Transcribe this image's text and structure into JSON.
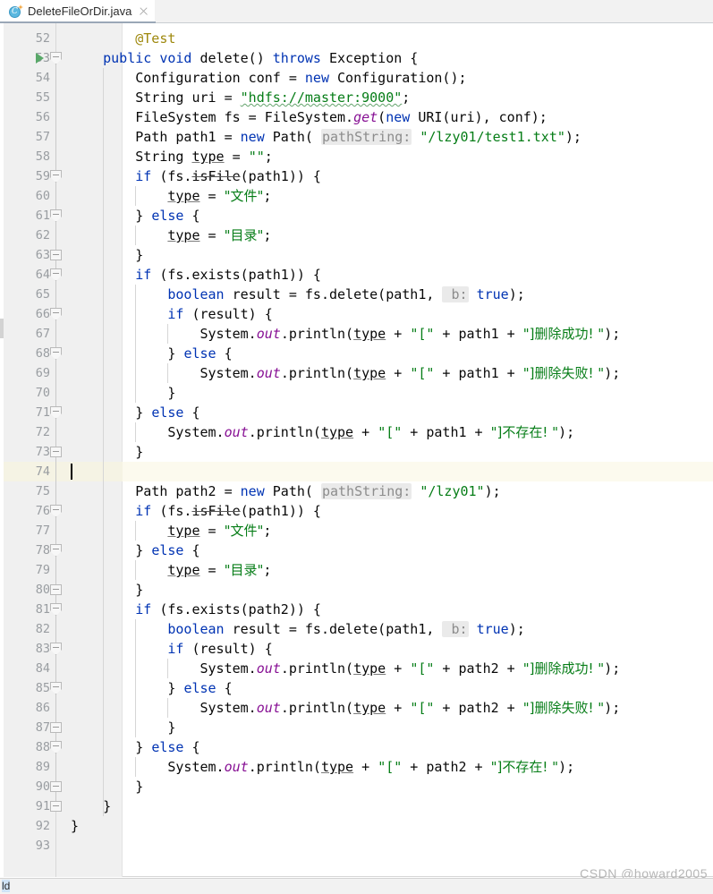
{
  "window": {
    "watermark": "CSDN @howard2005",
    "status_fragment": "ld"
  },
  "tabbar": {
    "tabs": [
      {
        "label": "DeleteFileOrDir.java",
        "icon": "java-class-icon",
        "icon_letter": "C",
        "close_icon": "close-icon",
        "active": true
      }
    ]
  },
  "editor": {
    "first_line": 52,
    "current_line": 74,
    "caret_line": 74,
    "colors": {
      "keyword": "#0033b3",
      "string": "#067d17",
      "annotation": "#9e880d",
      "static_member": "#871094",
      "gutter_bg": "#f0f0f0",
      "current_line_bg": "#fcfaee",
      "run_arrow": "#59a869",
      "tab_underline": "#9aa7b7"
    },
    "gutter": {
      "run_marker_line": 53,
      "fold_open_lines": [
        53,
        59,
        61,
        64,
        66,
        68,
        71,
        76,
        78,
        81,
        83,
        85,
        88
      ],
      "fold_close_lines": [
        63,
        73,
        80,
        87,
        90,
        91
      ]
    },
    "lines": [
      {
        "n": 52,
        "tokens": [
          {
            "t": "        ",
            "c": "plain"
          },
          {
            "t": "@Test",
            "c": "ann"
          }
        ]
      },
      {
        "n": 53,
        "tokens": [
          {
            "t": "    ",
            "c": "plain"
          },
          {
            "t": "public",
            "c": "kw"
          },
          {
            "t": " ",
            "c": "plain"
          },
          {
            "t": "void",
            "c": "kw"
          },
          {
            "t": " delete() ",
            "c": "plain"
          },
          {
            "t": "throws",
            "c": "kw"
          },
          {
            "t": " Exception {",
            "c": "plain"
          }
        ]
      },
      {
        "n": 54,
        "tokens": [
          {
            "t": "        Configuration conf = ",
            "c": "plain"
          },
          {
            "t": "new",
            "c": "kw"
          },
          {
            "t": " Configuration();",
            "c": "plain"
          }
        ]
      },
      {
        "n": 55,
        "tokens": [
          {
            "t": "        String uri = ",
            "c": "plain"
          },
          {
            "t": "\"hdfs://master:9000\"",
            "c": "str-squiggle"
          },
          {
            "t": ";",
            "c": "plain"
          }
        ]
      },
      {
        "n": 56,
        "tokens": [
          {
            "t": "        FileSystem fs = FileSystem.",
            "c": "plain"
          },
          {
            "t": "get",
            "c": "stat"
          },
          {
            "t": "(",
            "c": "plain"
          },
          {
            "t": "new",
            "c": "kw"
          },
          {
            "t": " URI(uri), conf);",
            "c": "plain"
          }
        ]
      },
      {
        "n": 57,
        "tokens": [
          {
            "t": "        Path path1 = ",
            "c": "plain"
          },
          {
            "t": "new",
            "c": "kw"
          },
          {
            "t": " Path( ",
            "c": "plain"
          },
          {
            "t": "pathString:",
            "c": "hint"
          },
          {
            "t": " ",
            "c": "plain"
          },
          {
            "t": "\"/lzy01/test1.txt\"",
            "c": "str"
          },
          {
            "t": ");",
            "c": "plain"
          }
        ]
      },
      {
        "n": 58,
        "tokens": [
          {
            "t": "        String ",
            "c": "plain"
          },
          {
            "t": "type",
            "c": "u"
          },
          {
            "t": " = ",
            "c": "plain"
          },
          {
            "t": "\"\"",
            "c": "str"
          },
          {
            "t": ";",
            "c": "plain"
          }
        ]
      },
      {
        "n": 59,
        "tokens": [
          {
            "t": "        ",
            "c": "plain"
          },
          {
            "t": "if",
            "c": "kw"
          },
          {
            "t": " (fs.",
            "c": "plain"
          },
          {
            "t": "isFile",
            "c": "strike"
          },
          {
            "t": "(path1)) {",
            "c": "plain"
          }
        ]
      },
      {
        "n": 60,
        "tokens": [
          {
            "t": "            ",
            "c": "plain"
          },
          {
            "t": "type",
            "c": "u"
          },
          {
            "t": " = ",
            "c": "plain"
          },
          {
            "t": "\"文件\"",
            "c": "str-cjk"
          },
          {
            "t": ";",
            "c": "plain"
          }
        ]
      },
      {
        "n": 61,
        "tokens": [
          {
            "t": "        } ",
            "c": "plain"
          },
          {
            "t": "else",
            "c": "kw"
          },
          {
            "t": " {",
            "c": "plain"
          }
        ]
      },
      {
        "n": 62,
        "tokens": [
          {
            "t": "            ",
            "c": "plain"
          },
          {
            "t": "type",
            "c": "u"
          },
          {
            "t": " = ",
            "c": "plain"
          },
          {
            "t": "\"目录\"",
            "c": "str-cjk"
          },
          {
            "t": ";",
            "c": "plain"
          }
        ]
      },
      {
        "n": 63,
        "tokens": [
          {
            "t": "        }",
            "c": "plain"
          }
        ]
      },
      {
        "n": 64,
        "tokens": [
          {
            "t": "        ",
            "c": "plain"
          },
          {
            "t": "if",
            "c": "kw"
          },
          {
            "t": " (fs.exists(path1)) {",
            "c": "plain"
          }
        ]
      },
      {
        "n": 65,
        "tokens": [
          {
            "t": "            ",
            "c": "plain"
          },
          {
            "t": "boolean",
            "c": "kw"
          },
          {
            "t": " result = fs.delete(path1, ",
            "c": "plain"
          },
          {
            "t": " b:",
            "c": "hint"
          },
          {
            "t": " ",
            "c": "plain"
          },
          {
            "t": "true",
            "c": "kw"
          },
          {
            "t": ");",
            "c": "plain"
          }
        ]
      },
      {
        "n": 66,
        "tokens": [
          {
            "t": "            ",
            "c": "plain"
          },
          {
            "t": "if",
            "c": "kw"
          },
          {
            "t": " (result) {",
            "c": "plain"
          }
        ]
      },
      {
        "n": 67,
        "tokens": [
          {
            "t": "                System.",
            "c": "plain"
          },
          {
            "t": "out",
            "c": "stat"
          },
          {
            "t": ".println(",
            "c": "plain"
          },
          {
            "t": "type",
            "c": "u"
          },
          {
            "t": " + ",
            "c": "plain"
          },
          {
            "t": "\"[\"",
            "c": "str"
          },
          {
            "t": " + path1 + ",
            "c": "plain"
          },
          {
            "t": "\"]删除成功! \"",
            "c": "str-cjk"
          },
          {
            "t": ");",
            "c": "plain"
          }
        ]
      },
      {
        "n": 68,
        "tokens": [
          {
            "t": "            } ",
            "c": "plain"
          },
          {
            "t": "else",
            "c": "kw"
          },
          {
            "t": " {",
            "c": "plain"
          }
        ]
      },
      {
        "n": 69,
        "tokens": [
          {
            "t": "                System.",
            "c": "plain"
          },
          {
            "t": "out",
            "c": "stat"
          },
          {
            "t": ".println(",
            "c": "plain"
          },
          {
            "t": "type",
            "c": "u"
          },
          {
            "t": " + ",
            "c": "plain"
          },
          {
            "t": "\"[\"",
            "c": "str"
          },
          {
            "t": " + path1 + ",
            "c": "plain"
          },
          {
            "t": "\"]删除失败! \"",
            "c": "str-cjk"
          },
          {
            "t": ");",
            "c": "plain"
          }
        ]
      },
      {
        "n": 70,
        "tokens": [
          {
            "t": "            }",
            "c": "plain"
          }
        ]
      },
      {
        "n": 71,
        "tokens": [
          {
            "t": "        } ",
            "c": "plain"
          },
          {
            "t": "else",
            "c": "kw"
          },
          {
            "t": " {",
            "c": "plain"
          }
        ]
      },
      {
        "n": 72,
        "tokens": [
          {
            "t": "            System.",
            "c": "plain"
          },
          {
            "t": "out",
            "c": "stat"
          },
          {
            "t": ".println(",
            "c": "plain"
          },
          {
            "t": "type",
            "c": "u"
          },
          {
            "t": " + ",
            "c": "plain"
          },
          {
            "t": "\"[\"",
            "c": "str"
          },
          {
            "t": " + path1 + ",
            "c": "plain"
          },
          {
            "t": "\"]不存在! \"",
            "c": "str-cjk"
          },
          {
            "t": ");",
            "c": "plain"
          }
        ]
      },
      {
        "n": 73,
        "tokens": [
          {
            "t": "        }",
            "c": "plain"
          }
        ]
      },
      {
        "n": 74,
        "tokens": []
      },
      {
        "n": 75,
        "tokens": [
          {
            "t": "        Path path2 = ",
            "c": "plain"
          },
          {
            "t": "new",
            "c": "kw"
          },
          {
            "t": " Path( ",
            "c": "plain"
          },
          {
            "t": "pathString:",
            "c": "hint"
          },
          {
            "t": " ",
            "c": "plain"
          },
          {
            "t": "\"/lzy01\"",
            "c": "str"
          },
          {
            "t": ");",
            "c": "plain"
          }
        ]
      },
      {
        "n": 76,
        "tokens": [
          {
            "t": "        ",
            "c": "plain"
          },
          {
            "t": "if",
            "c": "kw"
          },
          {
            "t": " (fs.",
            "c": "plain"
          },
          {
            "t": "isFile",
            "c": "strike"
          },
          {
            "t": "(path1)) {",
            "c": "plain"
          }
        ]
      },
      {
        "n": 77,
        "tokens": [
          {
            "t": "            ",
            "c": "plain"
          },
          {
            "t": "type",
            "c": "u"
          },
          {
            "t": " = ",
            "c": "plain"
          },
          {
            "t": "\"文件\"",
            "c": "str-cjk"
          },
          {
            "t": ";",
            "c": "plain"
          }
        ]
      },
      {
        "n": 78,
        "tokens": [
          {
            "t": "        } ",
            "c": "plain"
          },
          {
            "t": "else",
            "c": "kw"
          },
          {
            "t": " {",
            "c": "plain"
          }
        ]
      },
      {
        "n": 79,
        "tokens": [
          {
            "t": "            ",
            "c": "plain"
          },
          {
            "t": "type",
            "c": "u"
          },
          {
            "t": " = ",
            "c": "plain"
          },
          {
            "t": "\"目录\"",
            "c": "str-cjk"
          },
          {
            "t": ";",
            "c": "plain"
          }
        ]
      },
      {
        "n": 80,
        "tokens": [
          {
            "t": "        }",
            "c": "plain"
          }
        ]
      },
      {
        "n": 81,
        "tokens": [
          {
            "t": "        ",
            "c": "plain"
          },
          {
            "t": "if",
            "c": "kw"
          },
          {
            "t": " (fs.exists(path2)) {",
            "c": "plain"
          }
        ]
      },
      {
        "n": 82,
        "tokens": [
          {
            "t": "            ",
            "c": "plain"
          },
          {
            "t": "boolean",
            "c": "kw"
          },
          {
            "t": " result = fs.delete(path1, ",
            "c": "plain"
          },
          {
            "t": " b:",
            "c": "hint"
          },
          {
            "t": " ",
            "c": "plain"
          },
          {
            "t": "true",
            "c": "kw"
          },
          {
            "t": ");",
            "c": "plain"
          }
        ]
      },
      {
        "n": 83,
        "tokens": [
          {
            "t": "            ",
            "c": "plain"
          },
          {
            "t": "if",
            "c": "kw"
          },
          {
            "t": " (result) {",
            "c": "plain"
          }
        ]
      },
      {
        "n": 84,
        "tokens": [
          {
            "t": "                System.",
            "c": "plain"
          },
          {
            "t": "out",
            "c": "stat"
          },
          {
            "t": ".println(",
            "c": "plain"
          },
          {
            "t": "type",
            "c": "u"
          },
          {
            "t": " + ",
            "c": "plain"
          },
          {
            "t": "\"[\"",
            "c": "str"
          },
          {
            "t": " + path2 + ",
            "c": "plain"
          },
          {
            "t": "\"]删除成功! \"",
            "c": "str-cjk"
          },
          {
            "t": ");",
            "c": "plain"
          }
        ]
      },
      {
        "n": 85,
        "tokens": [
          {
            "t": "            } ",
            "c": "plain"
          },
          {
            "t": "else",
            "c": "kw"
          },
          {
            "t": " {",
            "c": "plain"
          }
        ]
      },
      {
        "n": 86,
        "tokens": [
          {
            "t": "                System.",
            "c": "plain"
          },
          {
            "t": "out",
            "c": "stat"
          },
          {
            "t": ".println(",
            "c": "plain"
          },
          {
            "t": "type",
            "c": "u"
          },
          {
            "t": " + ",
            "c": "plain"
          },
          {
            "t": "\"[\"",
            "c": "str"
          },
          {
            "t": " + path2 + ",
            "c": "plain"
          },
          {
            "t": "\"]删除失败! \"",
            "c": "str-cjk"
          },
          {
            "t": ");",
            "c": "plain"
          }
        ]
      },
      {
        "n": 87,
        "tokens": [
          {
            "t": "            }",
            "c": "plain"
          }
        ]
      },
      {
        "n": 88,
        "tokens": [
          {
            "t": "        } ",
            "c": "plain"
          },
          {
            "t": "else",
            "c": "kw"
          },
          {
            "t": " {",
            "c": "plain"
          }
        ]
      },
      {
        "n": 89,
        "tokens": [
          {
            "t": "            System.",
            "c": "plain"
          },
          {
            "t": "out",
            "c": "stat"
          },
          {
            "t": ".println(",
            "c": "plain"
          },
          {
            "t": "type",
            "c": "u"
          },
          {
            "t": " + ",
            "c": "plain"
          },
          {
            "t": "\"[\"",
            "c": "str"
          },
          {
            "t": " + path2 + ",
            "c": "plain"
          },
          {
            "t": "\"]不存在! \"",
            "c": "str-cjk"
          },
          {
            "t": ");",
            "c": "plain"
          }
        ]
      },
      {
        "n": 90,
        "tokens": [
          {
            "t": "        }",
            "c": "plain"
          }
        ]
      },
      {
        "n": 91,
        "tokens": [
          {
            "t": "    }",
            "c": "plain"
          }
        ]
      },
      {
        "n": 92,
        "tokens": [
          {
            "t": "}",
            "c": "plain"
          }
        ]
      },
      {
        "n": 93,
        "tokens": []
      }
    ]
  }
}
